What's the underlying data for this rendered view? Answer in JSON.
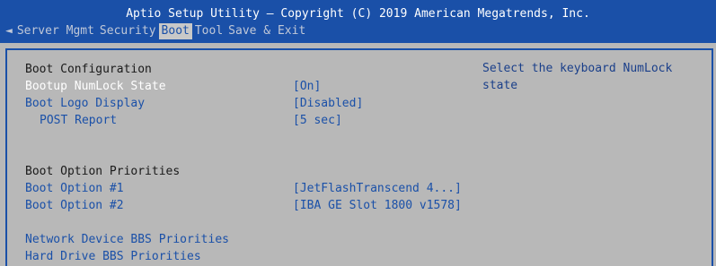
{
  "header": {
    "title": "Aptio Setup Utility – Copyright (C) 2019 American Megatrends, Inc.",
    "tabs": [
      {
        "label": "Server Mgmt"
      },
      {
        "label": "Security"
      },
      {
        "label": "Boot"
      },
      {
        "label": "Tool"
      },
      {
        "label": "Save & Exit"
      }
    ],
    "left_arrow": "◄"
  },
  "main": {
    "section_boot_config": "Boot Configuration",
    "bootup_numlock_label": "Bootup NumLock State",
    "bootup_numlock_value": "[On]",
    "boot_logo_label": "Boot Logo Display",
    "boot_logo_value": "[Disabled]",
    "post_report_label": "POST Report",
    "post_report_value": "[5 sec]",
    "section_boot_option_priorities": "Boot Option Priorities",
    "boot_option_1_label": "Boot Option #1",
    "boot_option_1_value": "[JetFlashTranscend 4...]",
    "boot_option_2_label": "Boot Option #2",
    "boot_option_2_value": "[IBA GE Slot 1800 v1578]",
    "network_bbs_label": "Network Device BBS Priorities",
    "hdd_bbs_label": "Hard Drive BBS Priorities"
  },
  "help": {
    "text": "Select the keyboard NumLock state"
  },
  "colors": {
    "header_bg": "#1a50a8",
    "panel_bg": "#b8b8b8",
    "link_text": "#1a50a8",
    "selected_text": "#ffffff"
  }
}
